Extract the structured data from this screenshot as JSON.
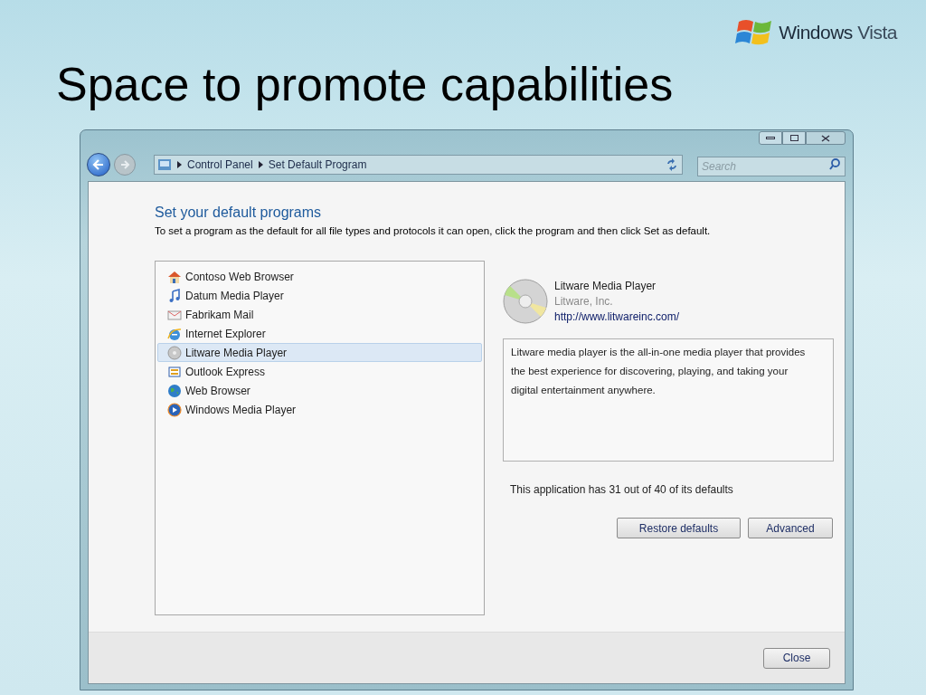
{
  "logo": {
    "words": [
      "Windows",
      "Vista"
    ]
  },
  "slide_title": "Space to promote capabilities",
  "window": {
    "breadcrumb": [
      "Control Panel",
      "Set Default Program"
    ],
    "search": {
      "placeholder": "Search"
    },
    "heading": "Set your default programs",
    "instruction": "To set a program as the default for all file types and protocols it can open, click the program and then click Set as default.",
    "programs": [
      {
        "kind": "house",
        "label": "Contoso Web Browser",
        "selected": false
      },
      {
        "kind": "note",
        "label": "Datum Media Player",
        "selected": false
      },
      {
        "kind": "mail",
        "label": "Fabrikam Mail",
        "selected": false
      },
      {
        "kind": "ie",
        "label": "Internet Explorer",
        "selected": false
      },
      {
        "kind": "disc",
        "label": "Litware Media Player",
        "selected": true
      },
      {
        "kind": "sync",
        "label": "Outlook Express",
        "selected": false
      },
      {
        "kind": "globe",
        "label": "Web Browser",
        "selected": false
      },
      {
        "kind": "media",
        "label": "Windows Media Player",
        "selected": false
      }
    ],
    "details": {
      "name": "Litware Media Player",
      "publisher": "Litware, Inc.",
      "url": "http://www.litwareinc.com/",
      "description": "Litware media player is the all-in-one media player that provides the best experience for discovering, playing, and taking your digital entertainment anywhere.",
      "status": "This application has 31 out of 40 of its defaults"
    },
    "buttons": [
      "Restore defaults",
      "Advanced"
    ],
    "footer_button": "Close"
  }
}
